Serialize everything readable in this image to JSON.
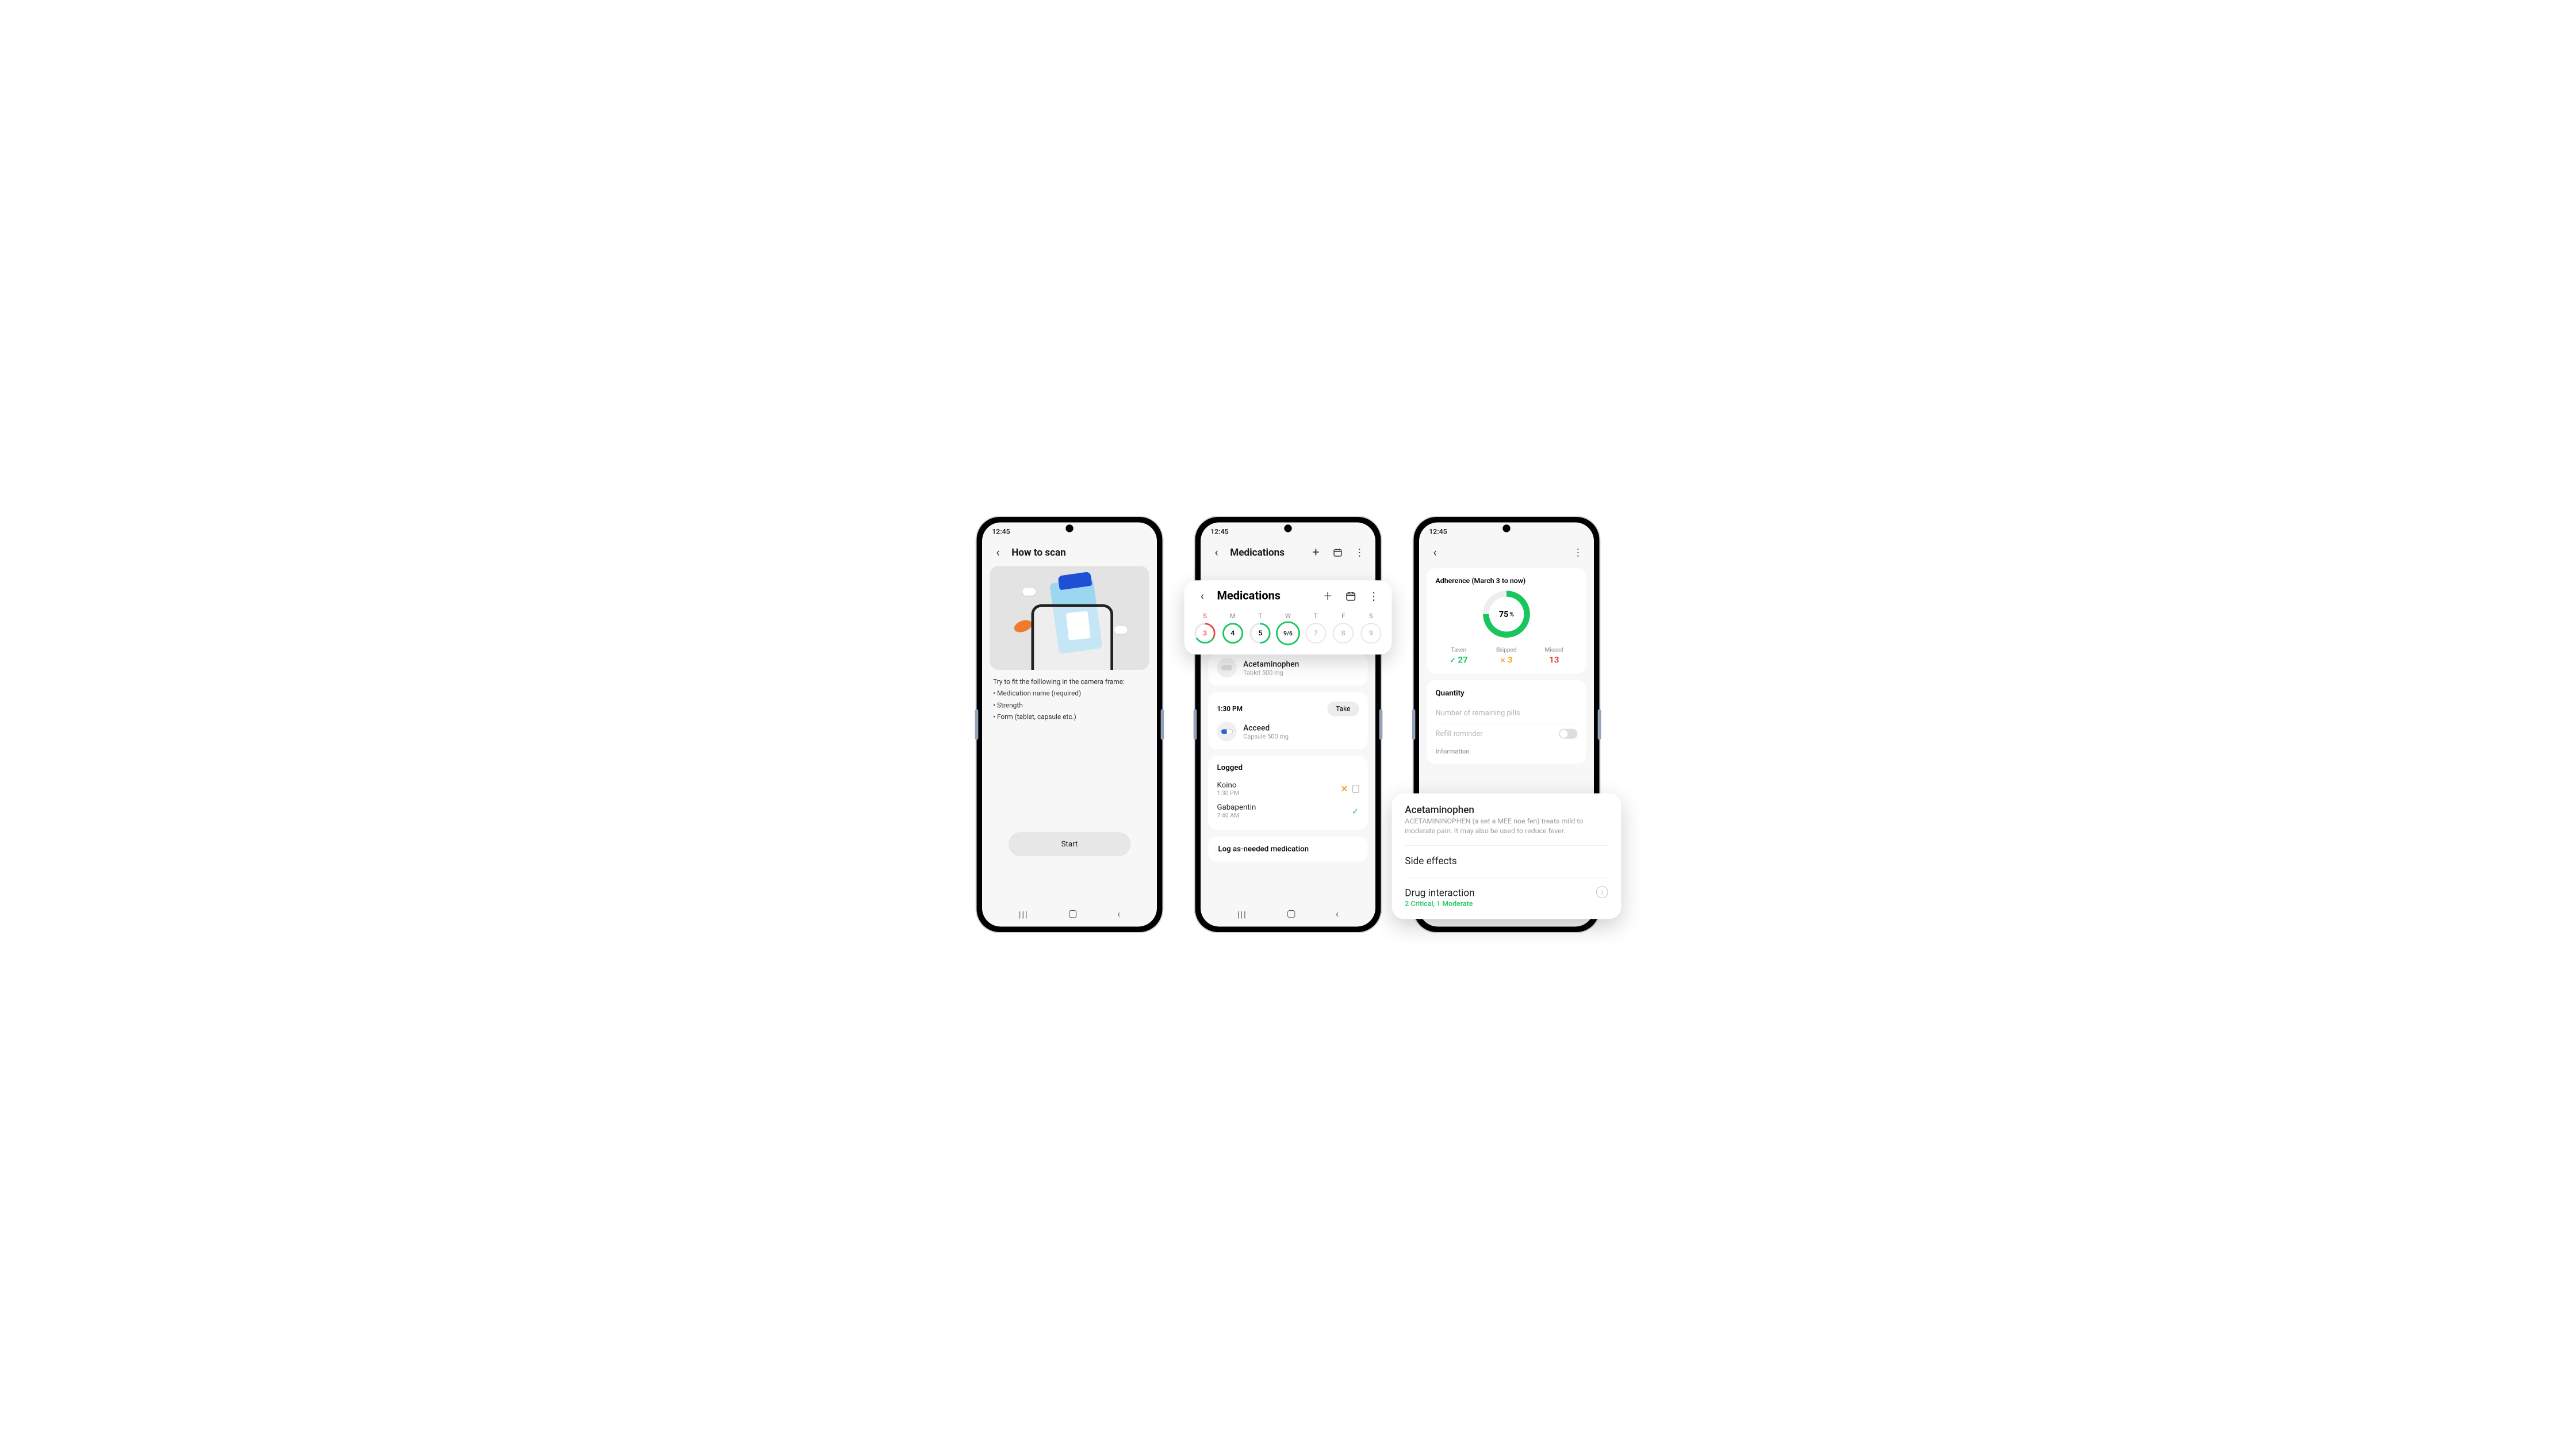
{
  "status_time": "12:45",
  "phone1": {
    "title": "How to scan",
    "instruction_lead": "Try to fit the folllowing in the camera frame:",
    "bullets": [
      "Medication name (required)",
      "Strength",
      "Form (tablet, capsule etc.)"
    ],
    "start": "Start"
  },
  "phone2": {
    "header_title": "Medications",
    "overlay_title": "Medications",
    "days": [
      {
        "label": "S",
        "num": "3",
        "style": "mixed",
        "sun": true
      },
      {
        "label": "M",
        "num": "4",
        "style": "full"
      },
      {
        "label": "T",
        "num": "5",
        "style": "half"
      },
      {
        "label": "W",
        "num": "9/6",
        "style": "sel"
      },
      {
        "label": "T",
        "num": "7",
        "style": "empty"
      },
      {
        "label": "F",
        "num": "8",
        "style": "empty"
      },
      {
        "label": "S",
        "num": "9",
        "style": "empty"
      }
    ],
    "med1": {
      "name": "Acetaminophen",
      "sub": "Tablet 500 mg"
    },
    "time_label": "1:30 PM",
    "take": "Take",
    "med2": {
      "name": "Acceed",
      "sub": "Capsule 500 mg"
    },
    "logged_title": "Logged",
    "log1": {
      "name": "Koino",
      "time": "1:30 PM"
    },
    "log2": {
      "name": "Gabapentin",
      "time": "7:40 AM"
    },
    "log_button": "Log as-needed medication"
  },
  "phone3": {
    "adh_title": "Adherence (March 3 to now)",
    "pct": "75",
    "pct_unit": "%",
    "stats": {
      "taken_lbl": "Taken",
      "taken": "27",
      "skipped_lbl": "Skipped",
      "skipped": "3",
      "missed_lbl": "Missed",
      "missed": "13"
    },
    "qty_title": "Quantity",
    "qty_placeholder": "Number of remaining pills",
    "refill_label": "Refill reminder",
    "info_label": "Information",
    "info": {
      "name": "Acetaminophen",
      "desc": "ACETAMININOPHEN (a set a MEE noe fen) treats mild to moderate pain. It may also be used to reduce fever.",
      "side": "Side effects",
      "inter_title": "Drug interaction",
      "inter_sub": "2 Critical, 1 Moderate"
    }
  }
}
